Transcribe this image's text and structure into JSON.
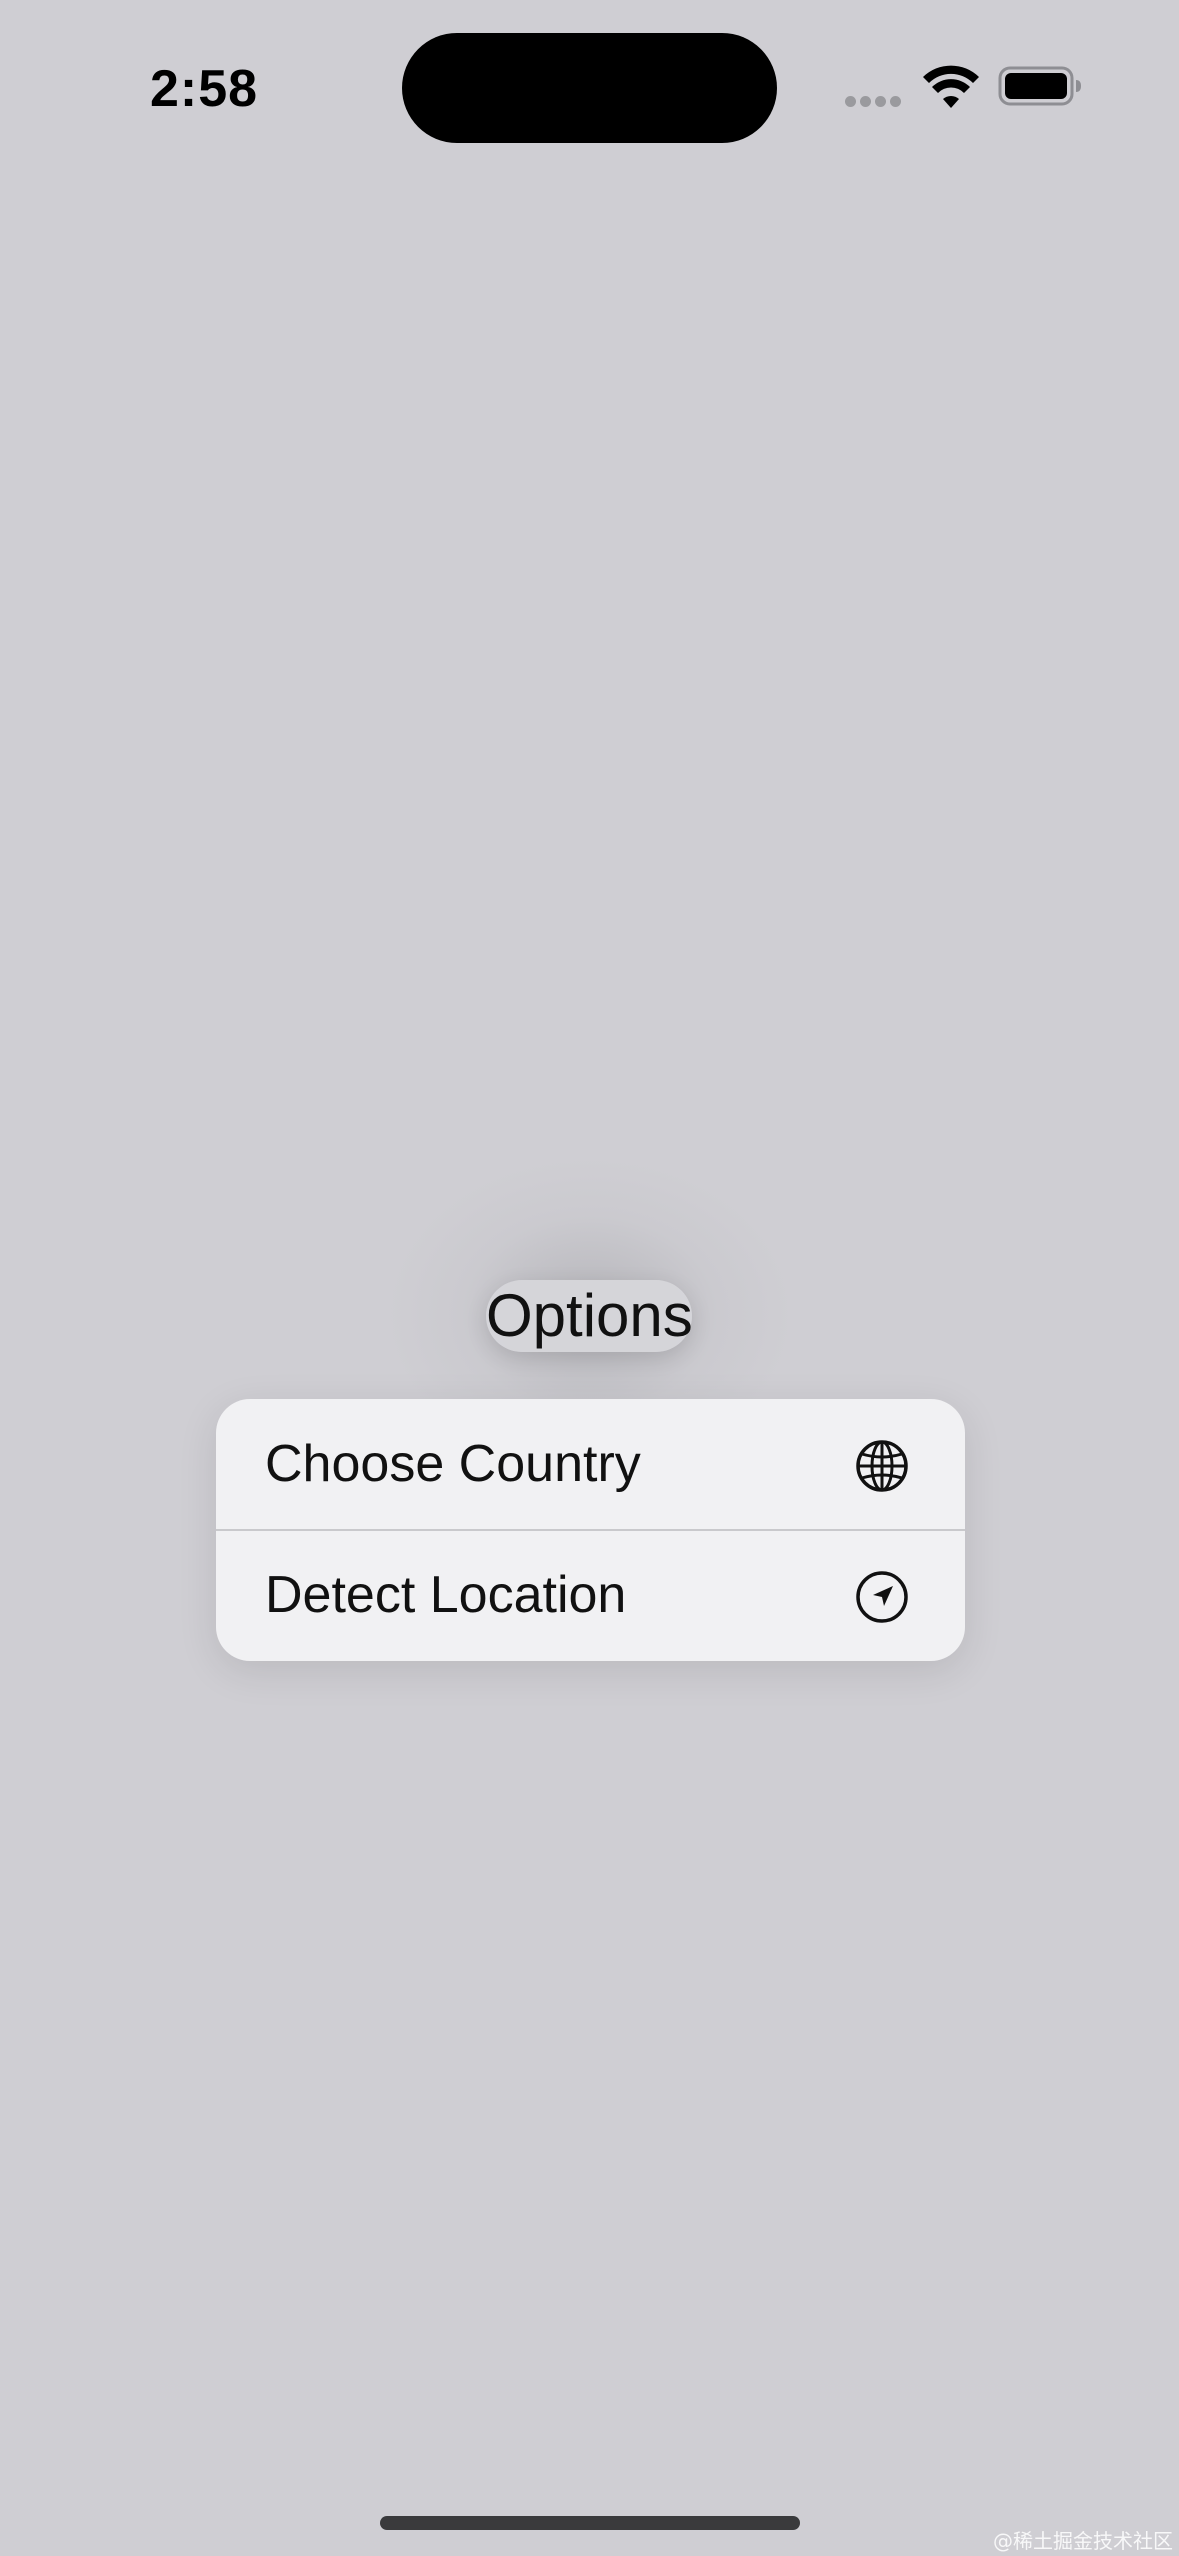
{
  "status_bar": {
    "time": "2:58",
    "signal_icon": "cellular-dots-icon",
    "wifi_icon": "wifi-icon",
    "battery_icon": "battery-icon"
  },
  "main": {
    "options_button_label": "Options"
  },
  "menu": {
    "items": [
      {
        "label": "Choose Country",
        "icon": "globe-icon"
      },
      {
        "label": "Detect Location",
        "icon": "location-arrow-icon"
      }
    ]
  },
  "watermark": "@稀土掘金技术社区",
  "colors": {
    "background": "#cfced3",
    "menu_background": "#f1f1f3",
    "text": "#111111"
  }
}
